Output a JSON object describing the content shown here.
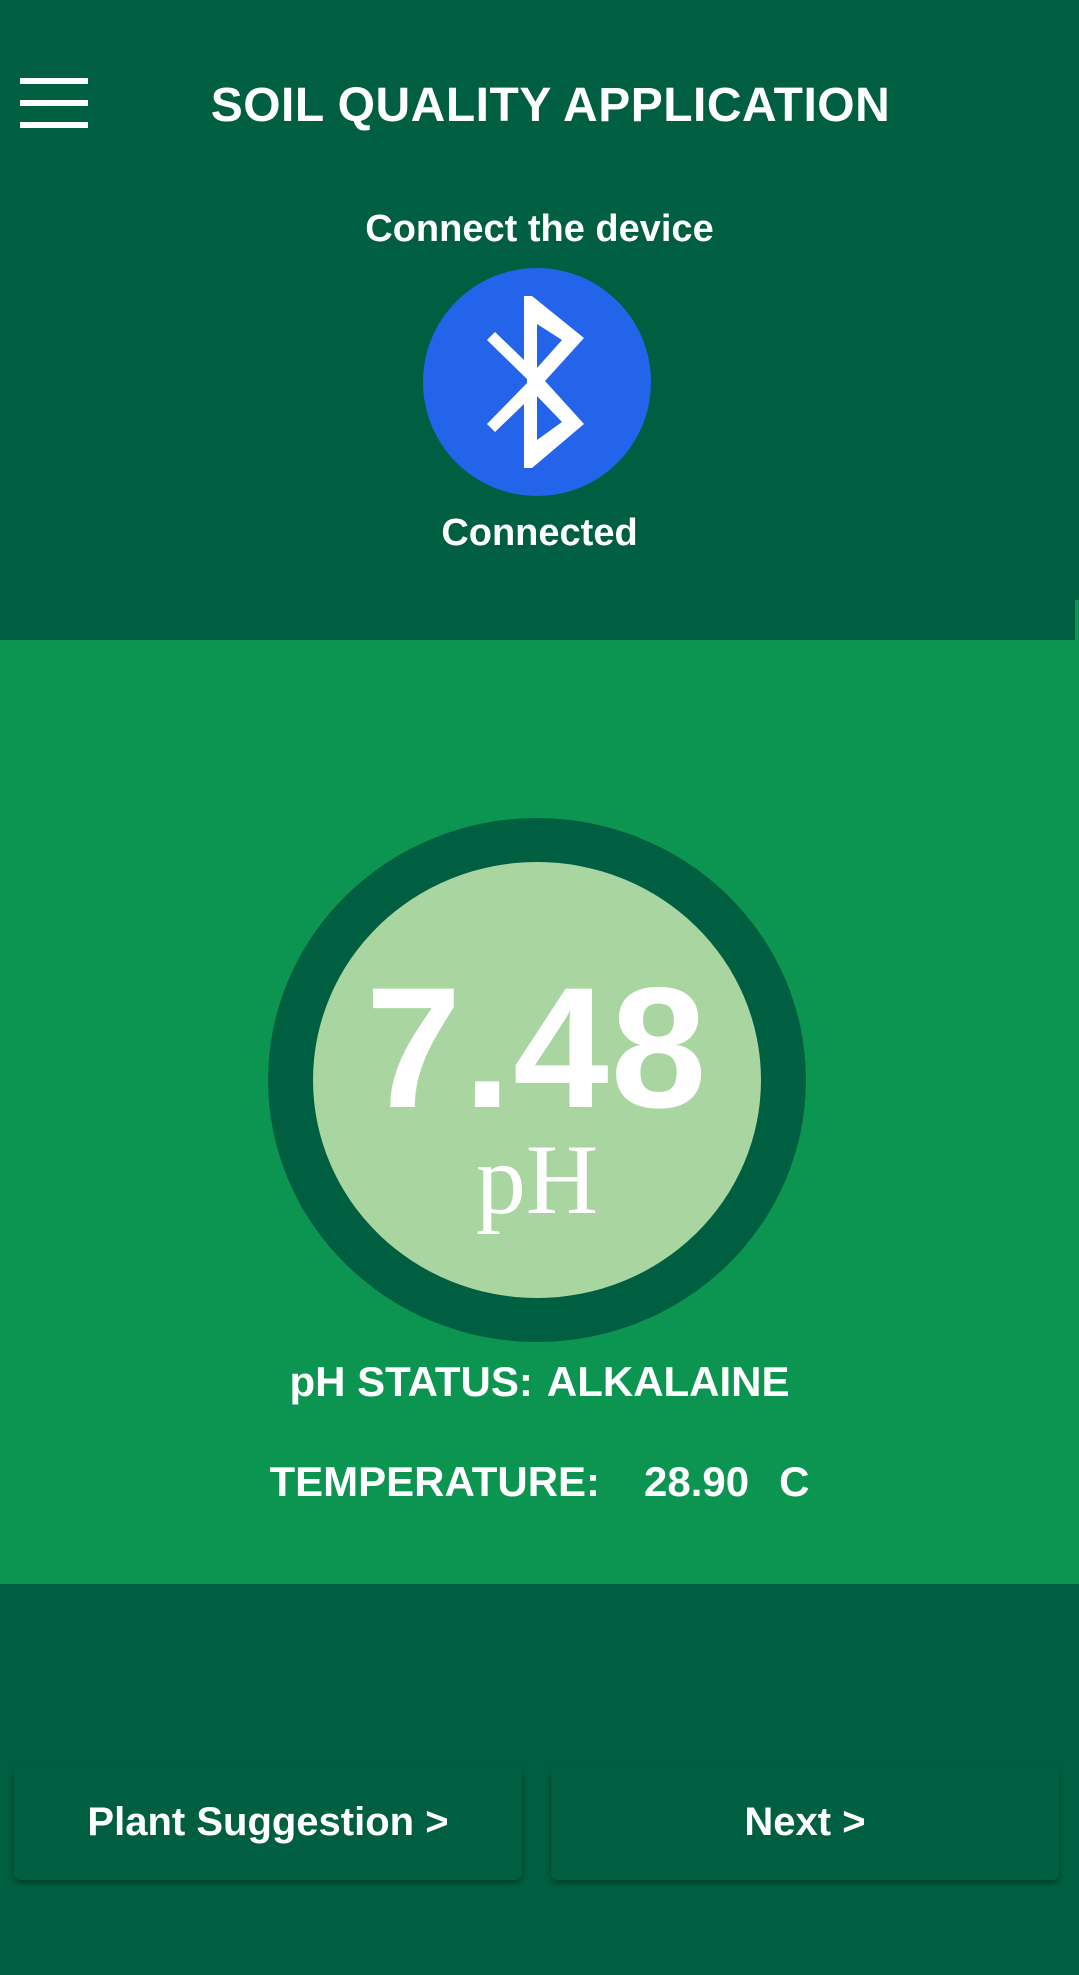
{
  "header": {
    "title": "SOIL QUALITY APPLICATION"
  },
  "device": {
    "connect_label": "Connect the device",
    "status": "Connected",
    "icon": "bluetooth-icon"
  },
  "reading": {
    "ph_value": "7.48",
    "ph_unit": "pH",
    "ph_status_label": "pH STATUS:",
    "ph_status_value": "ALKALAINE",
    "temperature_label": "TEMPERATURE:",
    "temperature_value": "28.90",
    "temperature_unit": "C"
  },
  "actions": {
    "plant_suggestion_label": "Plant Suggestion >",
    "next_label": "Next >"
  },
  "colors": {
    "background_dark": "#005f40",
    "panel_green": "#0c9550",
    "gauge_fill": "#a9d6a0",
    "bluetooth_blue": "#2364ea"
  }
}
